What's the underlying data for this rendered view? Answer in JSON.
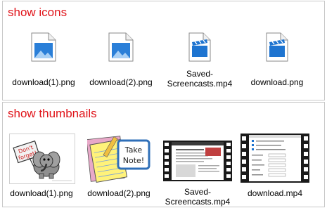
{
  "sections": {
    "icons": {
      "title": "show icons",
      "items": [
        {
          "label": "download(1).png",
          "icon": "image-file-icon"
        },
        {
          "label": "download(2).png",
          "icon": "image-file-icon"
        },
        {
          "label": "Saved-\nScreencasts.mp4",
          "icon": "video-file-icon"
        },
        {
          "label": "download.png",
          "icon": "video-file-icon"
        }
      ]
    },
    "thumbnails": {
      "title": "show thumbnails",
      "items": [
        {
          "label": "download(1).png",
          "thumb": "dont-forget-elephant"
        },
        {
          "label": "download(2).png",
          "thumb": "take-note-notepad"
        },
        {
          "label": "Saved-\nScreencasts.mp4",
          "thumb": "video-frame-webpage"
        },
        {
          "label": "download.mp4",
          "thumb": "video-frame-settings"
        }
      ]
    }
  },
  "thumb_text": {
    "dont": "Don't",
    "forget": "forget!",
    "take": "Take",
    "note": "Note!"
  },
  "colors": {
    "title": "#e0141a",
    "icon_blue": "#1e74d0",
    "border": "#c8c8c8"
  }
}
